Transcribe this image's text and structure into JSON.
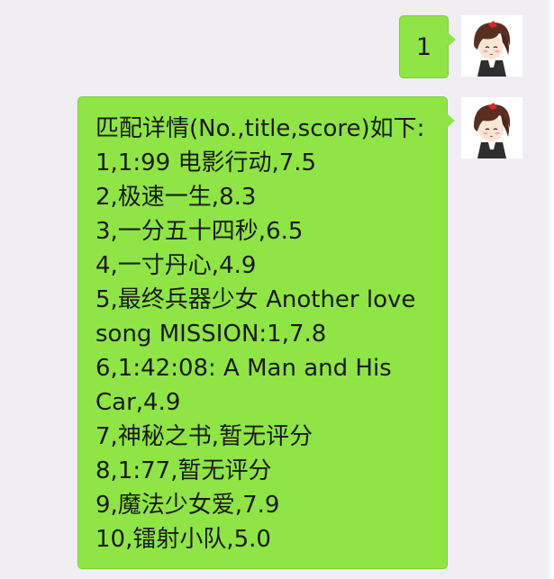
{
  "messages": [
    {
      "sender": "self",
      "text": "1"
    },
    {
      "sender": "self",
      "lines": [
        "匹配详情(No.,title,score)如下:",
        "1,1:99 电影行动,7.5",
        "2,极速一生,8.3",
        "3,一分五十四秒,6.5",
        "4,一寸丹心,4.9",
        "5,最终兵器少女 Another love",
        "song MISSION:1,7.8",
        "6,1:42:08: A Man and His",
        "Car,4.9",
        "7,神秘之书,暂无评分",
        "8,1:77,暂无评分",
        "9,魔法少女爱,7.9",
        "10,镭射小队,5.0"
      ]
    }
  ],
  "colors": {
    "background": "#f1eef3",
    "bubble": "#8fe545",
    "bubble_border": "#7dce3b"
  }
}
